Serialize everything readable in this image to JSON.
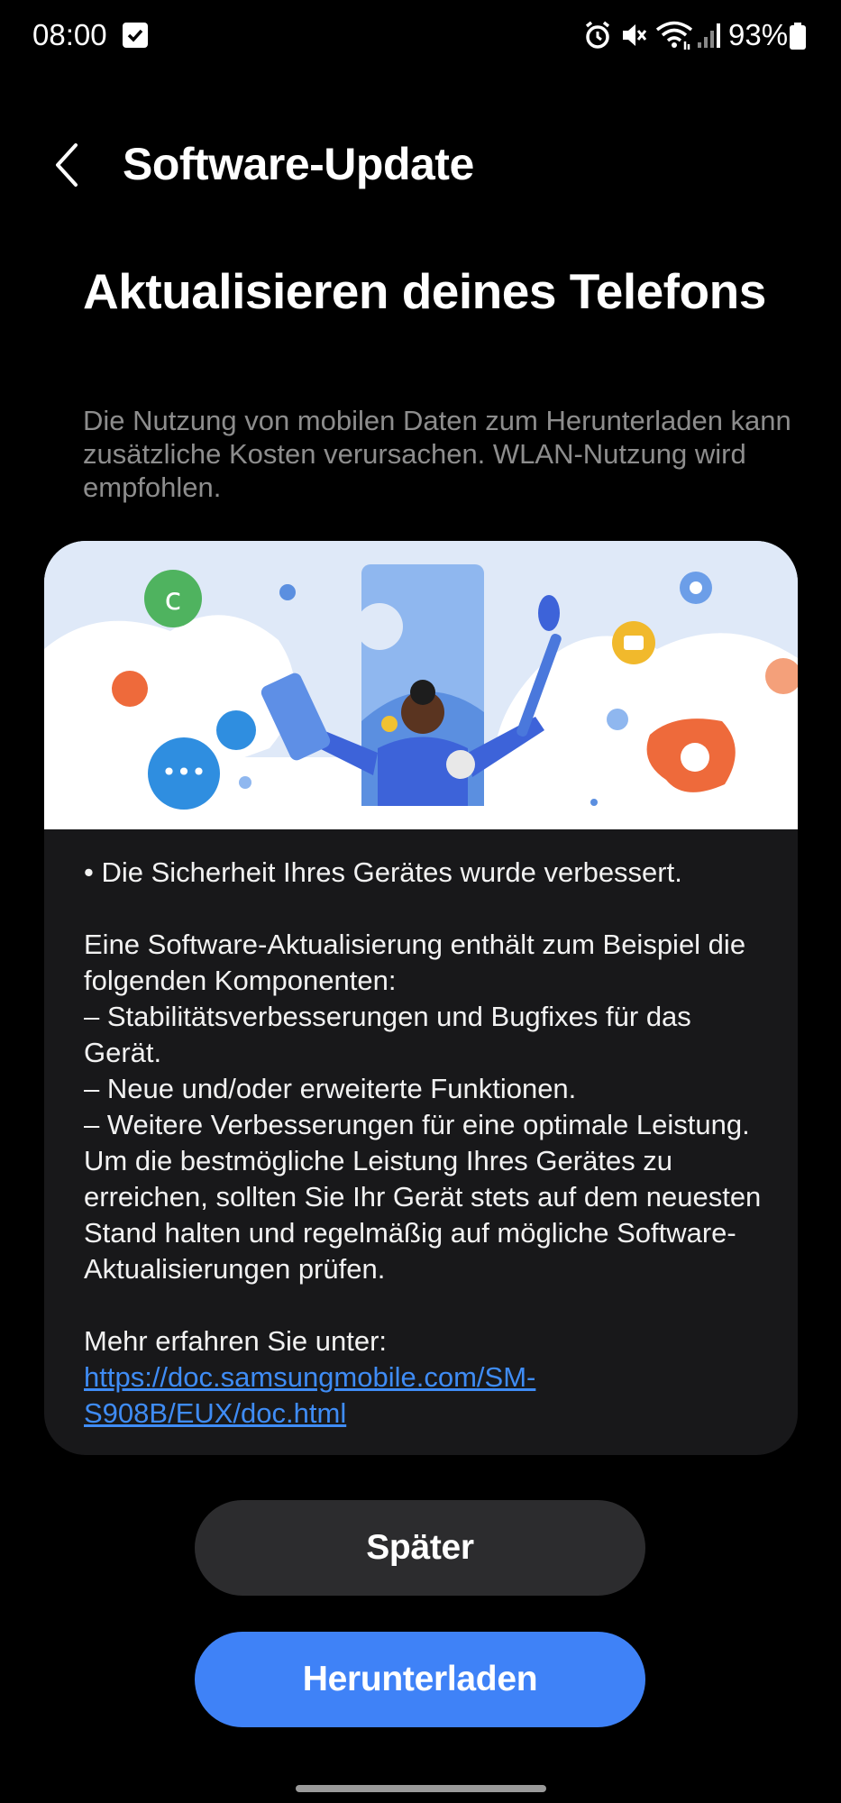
{
  "status_bar": {
    "time": "08:00",
    "battery_percent": "93%",
    "icons": [
      "checkbox-notification-icon",
      "alarm-icon",
      "mute-icon",
      "wifi-icon",
      "signal-icon",
      "battery-icon"
    ]
  },
  "header": {
    "title": "Software-Update",
    "back_icon": "back-arrow-icon"
  },
  "main": {
    "heading": "Aktualisieren deines Telefons",
    "warning": "Die Nutzung von mobilen Daten zum Herunterladen kann zusätzliche Kosten verursachen. WLAN-Nutzung wird empfohlen."
  },
  "card": {
    "bullet": "• Die Sicherheit Ihres Gerätes wurde verbessert.",
    "intro": "Eine Software-Aktualisierung enthält zum Beispiel die folgenden Komponenten:",
    "items": [
      " – Stabilitätsverbesserungen und Bugfixes für das Gerät.",
      " – Neue und/oder erweiterte Funktionen.",
      " – Weitere Verbesserungen für eine optimale Leistung."
    ],
    "recommendation": "Um die bestmögliche Leistung Ihres Gerätes zu erreichen, sollten Sie Ihr Gerät stets auf dem neuesten Stand halten und regelmäßig auf mögliche Software-Aktualisierungen prüfen.",
    "more_info": "Mehr erfahren Sie unter:",
    "link": "https://doc.samsungmobile.com/SM-S908B/EUX/doc.html"
  },
  "buttons": {
    "later": "Später",
    "download": "Herunterladen"
  },
  "colors": {
    "background": "#000000",
    "card": "#18181a",
    "accent": "#3f82f7",
    "secondary_button": "#2c2c2e",
    "link": "#3f8cf5"
  }
}
